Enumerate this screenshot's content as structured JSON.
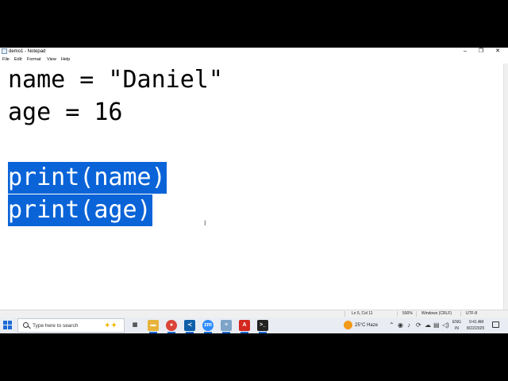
{
  "window": {
    "title": "demo1 - Notepad",
    "controls": {
      "minimize": "–",
      "maximize": "❐",
      "close": "✕"
    }
  },
  "menu": [
    "File",
    "Edit",
    "Format",
    "View",
    "Help"
  ],
  "editor": {
    "lines": [
      {
        "text": "name = \"Daniel\"",
        "selected": false
      },
      {
        "text": "age = 16",
        "selected": false
      },
      {
        "text": "",
        "selected": false
      },
      {
        "text": "print(name)",
        "selected": true
      },
      {
        "text": "print(age)",
        "selected": true
      }
    ],
    "selection_color": "#0a64d8"
  },
  "status": {
    "position": "Ln 5, Col 11",
    "zoom": "500%",
    "line_ending": "Windows (CRLF)",
    "encoding": "UTF-8"
  },
  "taskbar": {
    "search_placeholder": "Type here to search",
    "apps": [
      {
        "icon": "task-view-icon",
        "color": "#444444"
      },
      {
        "icon": "file-explorer-icon",
        "color": "#e8b33a"
      },
      {
        "icon": "chrome-icon",
        "color": "#db4437"
      },
      {
        "icon": "visual-studio-code-icon",
        "color": "#0f5fa8"
      },
      {
        "icon": "zoom-icon",
        "color": "#2d8cff"
      },
      {
        "icon": "notepad-icon",
        "color": "#7ea4c8"
      },
      {
        "icon": "acrobat-icon",
        "color": "#d3271f"
      },
      {
        "icon": "terminal-icon",
        "color": "#222222"
      }
    ],
    "weather": "25°C Haze",
    "language": [
      "ENG",
      "IN"
    ],
    "time": "9:41 AM",
    "date": "8/22/2025"
  }
}
